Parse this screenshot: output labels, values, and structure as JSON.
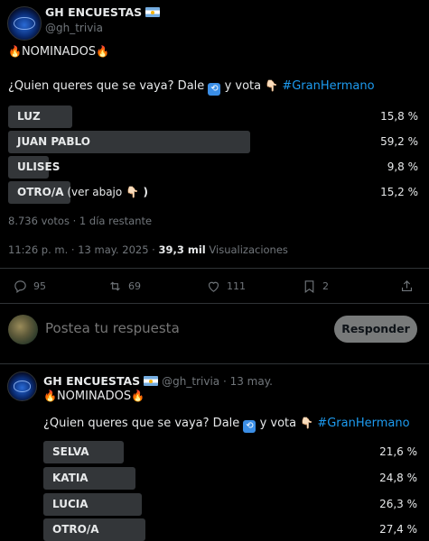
{
  "tweet1": {
    "display_name": "GH ENCUESTAS",
    "handle": "@gh_trivia",
    "heading": "NOMINADOS",
    "question_prefix": "¿Quien queres que se vaya? Dale",
    "question_middle": "y vota",
    "hashtag": "#GranHermano",
    "poll": [
      {
        "label": "LUZ",
        "label_suffix": "",
        "pct": "15,8 %",
        "value": 15.8
      },
      {
        "label": "JUAN PABLO",
        "label_suffix": "",
        "pct": "59,2 %",
        "value": 59.2
      },
      {
        "label": "ULISES",
        "label_suffix": "",
        "pct": "9,8 %",
        "value": 9.8
      },
      {
        "label": "OTRO/A",
        "label_suffix": " (ver abajo",
        "pct": "15,2 %",
        "value": 15.2
      }
    ],
    "votes_info": "8.736 votos · 1 día restante",
    "timestamp": "11:26 p. m. · 13 may. 2025 · ",
    "views_count": "39,3 mil",
    "views_label": " Visualizaciones",
    "actions": {
      "replies": "95",
      "retweets": "69",
      "likes": "111",
      "bookmarks": "2"
    }
  },
  "reply": {
    "placeholder": "Postea tu respuesta",
    "button_label": "Responder"
  },
  "tweet2": {
    "display_name": "GH ENCUESTAS",
    "handle_date": "@gh_trivia · 13 may.",
    "heading": "NOMINADOS",
    "question_prefix": "¿Quien queres que se vaya? Dale",
    "question_middle": "y vota",
    "hashtag": "#GranHermano",
    "poll": [
      {
        "label": "SELVA",
        "pct": "21,6 %",
        "value": 21.6
      },
      {
        "label": "KATIA",
        "pct": "24,8 %",
        "value": 24.8
      },
      {
        "label": "LUCIA",
        "pct": "26,3 %",
        "value": 26.3
      },
      {
        "label": "OTRO/A",
        "pct": "27,4 %",
        "value": 27.4
      }
    ]
  },
  "colors": {
    "background": "#000000",
    "poll_bar": "#333639",
    "accent": "#1d9bf0",
    "muted": "#71767b"
  }
}
